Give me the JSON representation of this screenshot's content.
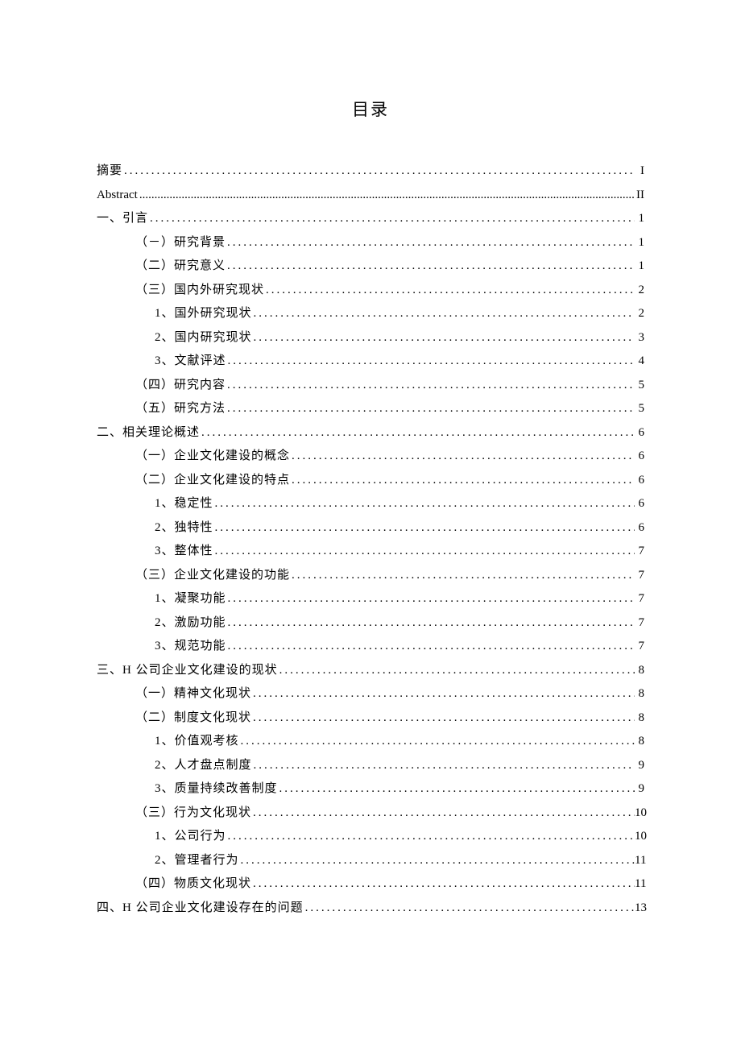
{
  "title": "目录",
  "entries": [
    {
      "label": "摘要",
      "page": "I",
      "level": 0
    },
    {
      "label": "Abstract",
      "page": "II",
      "level": 0,
      "en": true
    },
    {
      "label": "一、引言",
      "page": "1",
      "level": 0
    },
    {
      "label": "（－）研究背景",
      "page": "1",
      "level": 1
    },
    {
      "label": "（二）研究意义",
      "page": "1",
      "level": 1
    },
    {
      "label": "（三）国内外研究现状",
      "page": "2",
      "level": 1
    },
    {
      "label": "1、国外研究现状",
      "page": "2",
      "level": 2
    },
    {
      "label": "2、国内研究现状",
      "page": "3",
      "level": 2
    },
    {
      "label": "3、文献评述",
      "page": "4",
      "level": 2
    },
    {
      "label": "（四）研究内容",
      "page": "5",
      "level": 1
    },
    {
      "label": "（五）研究方法",
      "page": "5",
      "level": 1
    },
    {
      "label": "二、相关理论概述",
      "page": "6",
      "level": 0
    },
    {
      "label": "（一）企业文化建设的概念",
      "page": "6",
      "level": 1
    },
    {
      "label": "（二）企业文化建设的特点",
      "page": "6",
      "level": 1
    },
    {
      "label": "1、稳定性",
      "page": "6",
      "level": 2
    },
    {
      "label": "2、独特性",
      "page": "6",
      "level": 2
    },
    {
      "label": "3、整体性",
      "page": "7",
      "level": 2
    },
    {
      "label": "（三）企业文化建设的功能",
      "page": "7",
      "level": 1
    },
    {
      "label": "1、凝聚功能",
      "page": "7",
      "level": 2
    },
    {
      "label": "2、激励功能",
      "page": "7",
      "level": 2
    },
    {
      "label": "3、规范功能",
      "page": "7",
      "level": 2
    },
    {
      "label": "三、H 公司企业文化建设的现状",
      "page": "8",
      "level": 0
    },
    {
      "label": "（一）精神文化现状",
      "page": "8",
      "level": 1
    },
    {
      "label": "（二）制度文化现状",
      "page": "8",
      "level": 1
    },
    {
      "label": "1、价值观考核",
      "page": "8",
      "level": 2
    },
    {
      "label": "2、人才盘点制度",
      "page": "9",
      "level": 2
    },
    {
      "label": "3、质量持续改善制度",
      "page": "9",
      "level": 2
    },
    {
      "label": "（三）行为文化现状",
      "page": "10",
      "level": 1
    },
    {
      "label": "1、公司行为",
      "page": "10",
      "level": 2
    },
    {
      "label": "2、管理者行为",
      "page": "11",
      "level": 2
    },
    {
      "label": "（四）物质文化现状",
      "page": "11",
      "level": 1
    },
    {
      "label": "四、H 公司企业文化建设存在的问题",
      "page": "13",
      "level": 0
    }
  ]
}
